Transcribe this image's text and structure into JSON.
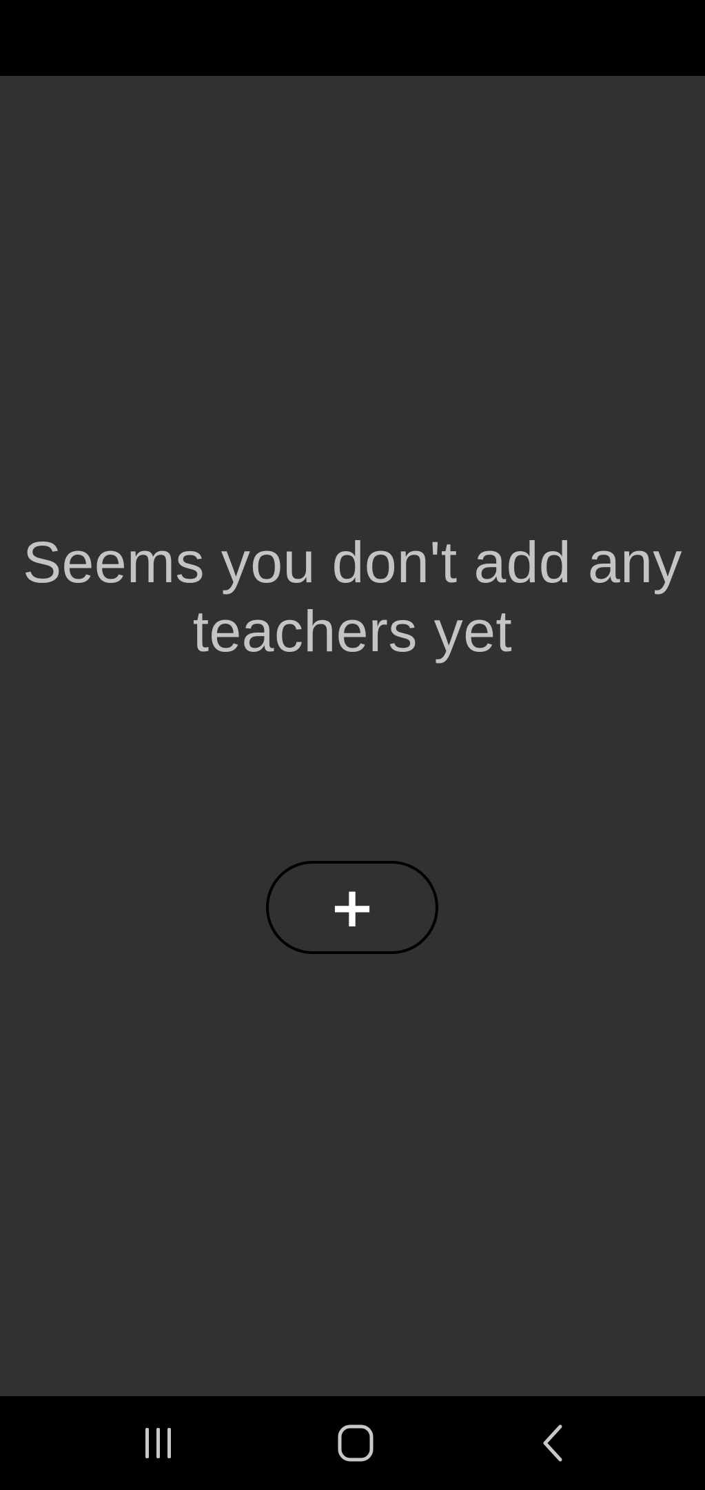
{
  "empty_state": {
    "message": "Seems you don't add any teachers yet"
  },
  "add_button": {
    "label": "+",
    "icon": "plus-icon"
  },
  "navigation_bar": {
    "buttons": [
      {
        "name": "recents",
        "icon": "recents-icon"
      },
      {
        "name": "home",
        "icon": "home-icon"
      },
      {
        "name": "back",
        "icon": "back-icon"
      }
    ]
  },
  "colors": {
    "background": "#313131",
    "system_bars": "#000000",
    "message_text": "#c4c4c4",
    "button_border": "#000000",
    "button_plus": "#ffffff",
    "nav_icons": "#c8c8c8"
  }
}
